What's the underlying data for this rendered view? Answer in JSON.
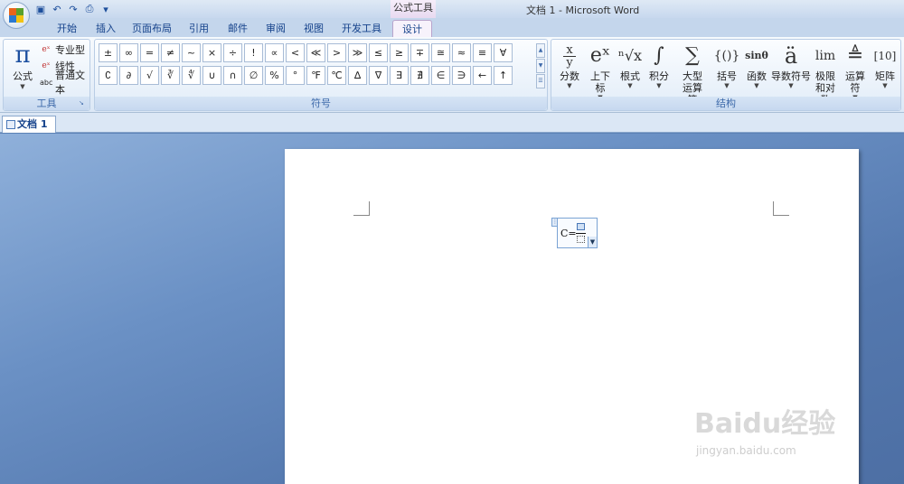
{
  "window": {
    "title": "文档 1 - Microsoft Word",
    "context_tab_title": "公式工具"
  },
  "tabs": [
    {
      "label": "开始"
    },
    {
      "label": "插入"
    },
    {
      "label": "页面布局"
    },
    {
      "label": "引用"
    },
    {
      "label": "邮件"
    },
    {
      "label": "审阅"
    },
    {
      "label": "视图"
    },
    {
      "label": "开发工具"
    },
    {
      "label": "设计"
    }
  ],
  "active_tab": "设计",
  "groups": {
    "tools": {
      "label": "工具",
      "equation_button": "公式",
      "items": [
        {
          "label": "专业型",
          "icon": "professional-format-icon"
        },
        {
          "label": "线性",
          "icon": "linear-format-icon"
        },
        {
          "label": "普通文本",
          "icon_text": "abc"
        }
      ]
    },
    "symbols": {
      "label": "符号",
      "row1": [
        "±",
        "∞",
        "=",
        "≠",
        "~",
        "×",
        "÷",
        "!",
        "∝",
        "<",
        "≪",
        ">",
        "≫",
        "≤",
        "≥",
        "∓",
        "≅",
        "≈",
        "≡",
        "∀"
      ],
      "row2": [
        "∁",
        "∂",
        "√",
        "∛",
        "∜",
        "∪",
        "∩",
        "∅",
        "%",
        "°",
        "℉",
        "℃",
        "∆",
        "∇",
        "∃",
        "∄",
        "∈",
        "∋",
        "←",
        "↑"
      ]
    },
    "structures": {
      "label": "结构",
      "items": [
        {
          "label": "分数",
          "glyph": "x/y"
        },
        {
          "label": "上下标",
          "glyph": "eˣ"
        },
        {
          "label": "根式",
          "glyph": "ⁿ√x"
        },
        {
          "label": "积分",
          "glyph": "∫"
        },
        {
          "label": "大型运算符",
          "glyph": "∑"
        },
        {
          "label": "括号",
          "glyph": "{()}"
        },
        {
          "label": "函数",
          "glyph": "sinθ"
        },
        {
          "label": "导数符号",
          "glyph": "ä"
        },
        {
          "label": "极限和对数",
          "glyph": "lim"
        },
        {
          "label": "运算符",
          "glyph": "≜"
        },
        {
          "label": "矩阵",
          "glyph": "[10]"
        }
      ]
    }
  },
  "document_tab": "文档 1 *",
  "equation": {
    "prefix": "C="
  },
  "watermark": {
    "brand": "Baidu经验",
    "url": "jingyan.baidu.com"
  }
}
